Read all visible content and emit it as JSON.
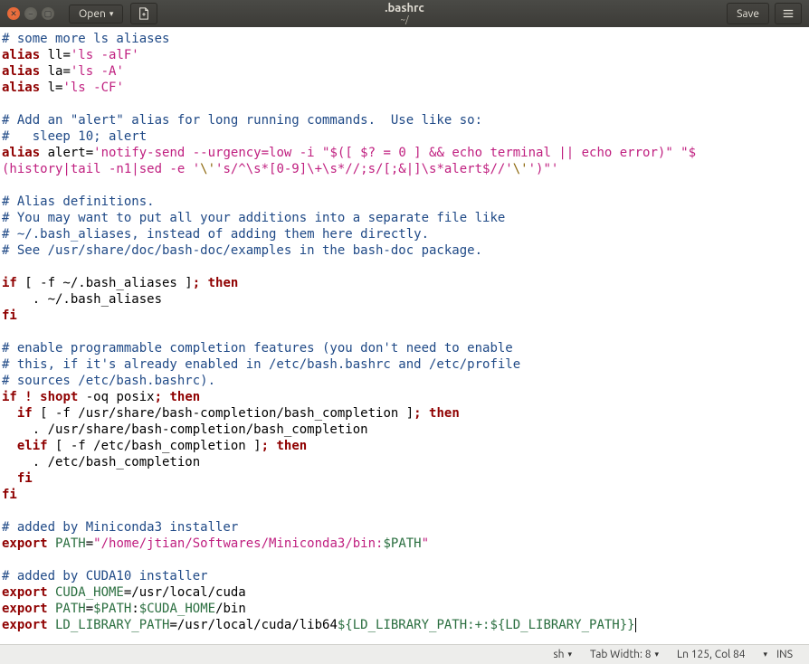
{
  "titlebar": {
    "open_label": "Open",
    "save_label": "Save",
    "title": ".bashrc",
    "subtitle": "~/"
  },
  "statusbar": {
    "lang": "sh",
    "tabwidth_label": "Tab Width: 8",
    "position": "Ln 125, Col 84",
    "mode": "INS"
  },
  "code": {
    "lines": [
      {
        "t": "cmt",
        "s": "# some more ls aliases"
      },
      {
        "t": "alias",
        "kw": "alias",
        "rest": " ll=",
        "str": "'ls -alF'"
      },
      {
        "t": "alias",
        "kw": "alias",
        "rest": " la=",
        "str": "'ls -A'"
      },
      {
        "t": "alias",
        "kw": "alias",
        "rest": " l=",
        "str": "'ls -CF'"
      },
      {
        "t": "blank"
      },
      {
        "t": "cmt",
        "s": "# Add an \"alert\" alias for long running commands.  Use like so:"
      },
      {
        "t": "cmt",
        "s": "#   sleep 10; alert"
      },
      {
        "t": "alert1"
      },
      {
        "t": "alert2"
      },
      {
        "t": "blank"
      },
      {
        "t": "cmt",
        "s": "# Alias definitions."
      },
      {
        "t": "cmt",
        "s": "# You may want to put all your additions into a separate file like"
      },
      {
        "t": "cmt",
        "s": "# ~/.bash_aliases, instead of adding them here directly."
      },
      {
        "t": "cmt",
        "s": "# See /usr/share/doc/bash-doc/examples in the bash-doc package."
      },
      {
        "t": "blank"
      },
      {
        "t": "if1"
      },
      {
        "t": "plain",
        "s": "    . ~/.bash_aliases"
      },
      {
        "t": "kw",
        "s": "fi"
      },
      {
        "t": "blank"
      },
      {
        "t": "cmt",
        "s": "# enable programmable completion features (you don't need to enable"
      },
      {
        "t": "cmt",
        "s": "# this, if it's already enabled in /etc/bash.bashrc and /etc/profile"
      },
      {
        "t": "cmt",
        "s": "# sources /etc/bash.bashrc)."
      },
      {
        "t": "if2"
      },
      {
        "t": "if3"
      },
      {
        "t": "plain",
        "s": "    . /usr/share/bash-completion/bash_completion"
      },
      {
        "t": "elif1"
      },
      {
        "t": "plain",
        "s": "    . /etc/bash_completion"
      },
      {
        "t": "kwi",
        "s": "  fi"
      },
      {
        "t": "kw",
        "s": "fi"
      },
      {
        "t": "blank"
      },
      {
        "t": "cmt",
        "s": "# added by Miniconda3 installer"
      },
      {
        "t": "export_str",
        "kw": "export",
        "var": " PATH",
        "eq": "=",
        "str": "\"/home/jtian/Softwares/Miniconda3/bin:",
        "varx": "$PATH",
        "strend": "\""
      },
      {
        "t": "blank"
      },
      {
        "t": "cmt",
        "s": "# added by CUDA10 installer"
      },
      {
        "t": "export_pl",
        "kw": "export",
        "var": " CUDA_HOME",
        "rest": "=/usr/local/cuda"
      },
      {
        "t": "export_path"
      },
      {
        "t": "export_ld"
      }
    ]
  }
}
